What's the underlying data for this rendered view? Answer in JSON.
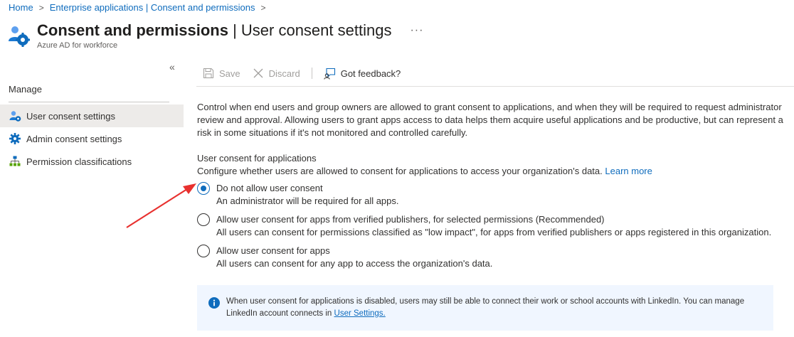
{
  "breadcrumb": {
    "home": "Home",
    "parent": "Enterprise applications | Consent and permissions"
  },
  "header": {
    "title_bold": "Consent and permissions",
    "title_rest": " | User consent settings",
    "more": "···",
    "subtitle": "Azure AD for workforce"
  },
  "sidebar": {
    "collapse": "«",
    "section": "Manage",
    "items": [
      {
        "label": "User consent settings",
        "icon": "user-gear-icon",
        "active": true
      },
      {
        "label": "Admin consent settings",
        "icon": "gear-icon",
        "active": false
      },
      {
        "label": "Permission classifications",
        "icon": "hierarchy-icon",
        "active": false
      }
    ]
  },
  "toolbar": {
    "save_label": "Save",
    "discard_label": "Discard",
    "feedback_label": "Got feedback?"
  },
  "content": {
    "description": "Control when end users and group owners are allowed to grant consent to applications, and when they will be required to request administrator review and approval. Allowing users to grant apps access to data helps them acquire useful applications and be productive, but can represent a risk in some situations if it's not monitored and controlled carefully.",
    "section_title": "User consent for applications",
    "section_desc": "Configure whether users are allowed to consent for applications to access your organization's data.",
    "learn_more": "Learn more",
    "options": [
      {
        "label": "Do not allow user consent",
        "help": "An administrator will be required for all apps.",
        "checked": true
      },
      {
        "label": "Allow user consent for apps from verified publishers, for selected permissions (Recommended)",
        "help": "All users can consent for permissions classified as \"low impact\", for apps from verified publishers or apps registered in this organization.",
        "checked": false
      },
      {
        "label": "Allow user consent for apps",
        "help": "All users can consent for any app to access the organization's data.",
        "checked": false
      }
    ]
  },
  "info": {
    "text": "When user consent for applications is disabled, users may still be able to connect their work or school accounts with LinkedIn. You can manage LinkedIn account connects in ",
    "link": "User Settings."
  },
  "colors": {
    "accent": "#0f6cbd",
    "annotation_arrow": "#e8312f",
    "info_background": "#f0f6ff"
  }
}
